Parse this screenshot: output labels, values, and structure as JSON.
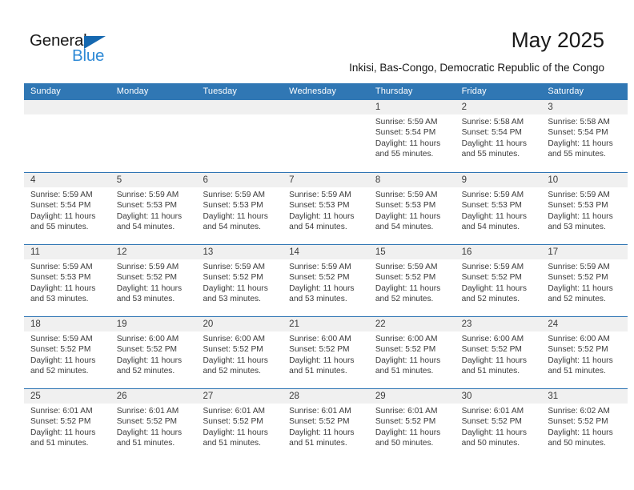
{
  "brand": {
    "word_one": "General",
    "word_two": "Blue",
    "triangle_icon": "triangle-icon",
    "colors": {
      "dark": "#1a1a1a",
      "blue": "#2f8ad6",
      "triangle": "#1568b0"
    }
  },
  "header": {
    "title": "May 2025",
    "subtitle": "Inkisi, Bas-Congo, Democratic Republic of the Congo"
  },
  "theme": {
    "header_blue": "#3077b4",
    "row_rule_blue": "#2e74b3",
    "datebar_gray": "#f0f0f0",
    "text": "#3b3b3b"
  },
  "calendar": {
    "day_headers": [
      "Sunday",
      "Monday",
      "Tuesday",
      "Wednesday",
      "Thursday",
      "Friday",
      "Saturday"
    ],
    "weeks": [
      [
        {
          "date": "",
          "empty": true,
          "sunrise": "",
          "sunset": "",
          "daylight": ""
        },
        {
          "date": "",
          "empty": true,
          "sunrise": "",
          "sunset": "",
          "daylight": ""
        },
        {
          "date": "",
          "empty": true,
          "sunrise": "",
          "sunset": "",
          "daylight": ""
        },
        {
          "date": "",
          "empty": true,
          "sunrise": "",
          "sunset": "",
          "daylight": ""
        },
        {
          "date": "1",
          "empty": false,
          "sunrise": "Sunrise: 5:59 AM",
          "sunset": "Sunset: 5:54 PM",
          "daylight": "Daylight: 11 hours and 55 minutes."
        },
        {
          "date": "2",
          "empty": false,
          "sunrise": "Sunrise: 5:58 AM",
          "sunset": "Sunset: 5:54 PM",
          "daylight": "Daylight: 11 hours and 55 minutes."
        },
        {
          "date": "3",
          "empty": false,
          "sunrise": "Sunrise: 5:58 AM",
          "sunset": "Sunset: 5:54 PM",
          "daylight": "Daylight: 11 hours and 55 minutes."
        }
      ],
      [
        {
          "date": "4",
          "empty": false,
          "sunrise": "Sunrise: 5:59 AM",
          "sunset": "Sunset: 5:54 PM",
          "daylight": "Daylight: 11 hours and 55 minutes."
        },
        {
          "date": "5",
          "empty": false,
          "sunrise": "Sunrise: 5:59 AM",
          "sunset": "Sunset: 5:53 PM",
          "daylight": "Daylight: 11 hours and 54 minutes."
        },
        {
          "date": "6",
          "empty": false,
          "sunrise": "Sunrise: 5:59 AM",
          "sunset": "Sunset: 5:53 PM",
          "daylight": "Daylight: 11 hours and 54 minutes."
        },
        {
          "date": "7",
          "empty": false,
          "sunrise": "Sunrise: 5:59 AM",
          "sunset": "Sunset: 5:53 PM",
          "daylight": "Daylight: 11 hours and 54 minutes."
        },
        {
          "date": "8",
          "empty": false,
          "sunrise": "Sunrise: 5:59 AM",
          "sunset": "Sunset: 5:53 PM",
          "daylight": "Daylight: 11 hours and 54 minutes."
        },
        {
          "date": "9",
          "empty": false,
          "sunrise": "Sunrise: 5:59 AM",
          "sunset": "Sunset: 5:53 PM",
          "daylight": "Daylight: 11 hours and 54 minutes."
        },
        {
          "date": "10",
          "empty": false,
          "sunrise": "Sunrise: 5:59 AM",
          "sunset": "Sunset: 5:53 PM",
          "daylight": "Daylight: 11 hours and 53 minutes."
        }
      ],
      [
        {
          "date": "11",
          "empty": false,
          "sunrise": "Sunrise: 5:59 AM",
          "sunset": "Sunset: 5:53 PM",
          "daylight": "Daylight: 11 hours and 53 minutes."
        },
        {
          "date": "12",
          "empty": false,
          "sunrise": "Sunrise: 5:59 AM",
          "sunset": "Sunset: 5:52 PM",
          "daylight": "Daylight: 11 hours and 53 minutes."
        },
        {
          "date": "13",
          "empty": false,
          "sunrise": "Sunrise: 5:59 AM",
          "sunset": "Sunset: 5:52 PM",
          "daylight": "Daylight: 11 hours and 53 minutes."
        },
        {
          "date": "14",
          "empty": false,
          "sunrise": "Sunrise: 5:59 AM",
          "sunset": "Sunset: 5:52 PM",
          "daylight": "Daylight: 11 hours and 53 minutes."
        },
        {
          "date": "15",
          "empty": false,
          "sunrise": "Sunrise: 5:59 AM",
          "sunset": "Sunset: 5:52 PM",
          "daylight": "Daylight: 11 hours and 52 minutes."
        },
        {
          "date": "16",
          "empty": false,
          "sunrise": "Sunrise: 5:59 AM",
          "sunset": "Sunset: 5:52 PM",
          "daylight": "Daylight: 11 hours and 52 minutes."
        },
        {
          "date": "17",
          "empty": false,
          "sunrise": "Sunrise: 5:59 AM",
          "sunset": "Sunset: 5:52 PM",
          "daylight": "Daylight: 11 hours and 52 minutes."
        }
      ],
      [
        {
          "date": "18",
          "empty": false,
          "sunrise": "Sunrise: 5:59 AM",
          "sunset": "Sunset: 5:52 PM",
          "daylight": "Daylight: 11 hours and 52 minutes."
        },
        {
          "date": "19",
          "empty": false,
          "sunrise": "Sunrise: 6:00 AM",
          "sunset": "Sunset: 5:52 PM",
          "daylight": "Daylight: 11 hours and 52 minutes."
        },
        {
          "date": "20",
          "empty": false,
          "sunrise": "Sunrise: 6:00 AM",
          "sunset": "Sunset: 5:52 PM",
          "daylight": "Daylight: 11 hours and 52 minutes."
        },
        {
          "date": "21",
          "empty": false,
          "sunrise": "Sunrise: 6:00 AM",
          "sunset": "Sunset: 5:52 PM",
          "daylight": "Daylight: 11 hours and 51 minutes."
        },
        {
          "date": "22",
          "empty": false,
          "sunrise": "Sunrise: 6:00 AM",
          "sunset": "Sunset: 5:52 PM",
          "daylight": "Daylight: 11 hours and 51 minutes."
        },
        {
          "date": "23",
          "empty": false,
          "sunrise": "Sunrise: 6:00 AM",
          "sunset": "Sunset: 5:52 PM",
          "daylight": "Daylight: 11 hours and 51 minutes."
        },
        {
          "date": "24",
          "empty": false,
          "sunrise": "Sunrise: 6:00 AM",
          "sunset": "Sunset: 5:52 PM",
          "daylight": "Daylight: 11 hours and 51 minutes."
        }
      ],
      [
        {
          "date": "25",
          "empty": false,
          "sunrise": "Sunrise: 6:01 AM",
          "sunset": "Sunset: 5:52 PM",
          "daylight": "Daylight: 11 hours and 51 minutes."
        },
        {
          "date": "26",
          "empty": false,
          "sunrise": "Sunrise: 6:01 AM",
          "sunset": "Sunset: 5:52 PM",
          "daylight": "Daylight: 11 hours and 51 minutes."
        },
        {
          "date": "27",
          "empty": false,
          "sunrise": "Sunrise: 6:01 AM",
          "sunset": "Sunset: 5:52 PM",
          "daylight": "Daylight: 11 hours and 51 minutes."
        },
        {
          "date": "28",
          "empty": false,
          "sunrise": "Sunrise: 6:01 AM",
          "sunset": "Sunset: 5:52 PM",
          "daylight": "Daylight: 11 hours and 51 minutes."
        },
        {
          "date": "29",
          "empty": false,
          "sunrise": "Sunrise: 6:01 AM",
          "sunset": "Sunset: 5:52 PM",
          "daylight": "Daylight: 11 hours and 50 minutes."
        },
        {
          "date": "30",
          "empty": false,
          "sunrise": "Sunrise: 6:01 AM",
          "sunset": "Sunset: 5:52 PM",
          "daylight": "Daylight: 11 hours and 50 minutes."
        },
        {
          "date": "31",
          "empty": false,
          "sunrise": "Sunrise: 6:02 AM",
          "sunset": "Sunset: 5:52 PM",
          "daylight": "Daylight: 11 hours and 50 minutes."
        }
      ]
    ]
  }
}
